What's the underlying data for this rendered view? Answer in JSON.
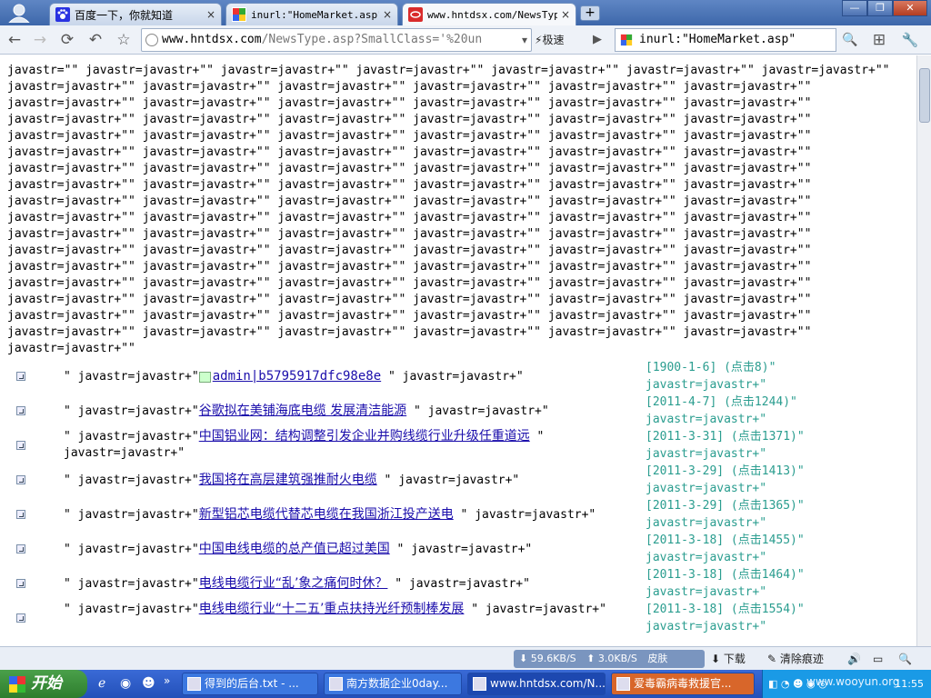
{
  "tabs": [
    {
      "title": "百度一下，你就知道",
      "close": "×"
    },
    {
      "title": "inurl:\"HomeMarket.asp\" -",
      "close": "×"
    },
    {
      "title": "www.hntdsx.com/NewsType.",
      "close": "×"
    }
  ],
  "newtab_label": "+",
  "window_controls": {
    "min": "—",
    "restore": "❐",
    "close": "✕"
  },
  "toolbar": {
    "back": "←",
    "forward": "→",
    "reload": "⟳",
    "undo": "↶",
    "star": "☆",
    "address_host": "www.hntdsx.com",
    "address_rest": "/NewsType.asp?SmallClass='%20un",
    "dropdown": "▾",
    "speed_label": "极速",
    "go": "▶",
    "search_query": "inurl:\"HomeMarket.asp\"",
    "search_btn": "🔍",
    "ext": "⊞",
    "tools": "🔧"
  },
  "junk_text": "javastr=\"\" javastr=javastr+\"\" javastr=javastr+\"\" javastr=javastr+\"\" javastr=javastr+\"\" javastr=javastr+\"\" javastr=javastr+\"\"\njavastr=javastr+\"\" javastr=javastr+\"\" javastr=javastr+\"\" javastr=javastr+\"\" javastr=javastr+\"\" javastr=javastr+\"\"\njavastr=javastr+\"\" javastr=javastr+\"\" javastr=javastr+\"\" javastr=javastr+\"\" javastr=javastr+\"\" javastr=javastr+\"\"\njavastr=javastr+\"\" javastr=javastr+\"\" javastr=javastr+\"\" javastr=javastr+\"\" javastr=javastr+\"\" javastr=javastr+\"\"\njavastr=javastr+\"\" javastr=javastr+\"\" javastr=javastr+\"\" javastr=javastr+\"\" javastr=javastr+\"\" javastr=javastr+\"\"\njavastr=javastr+\"\" javastr=javastr+\"\" javastr=javastr+\"\" javastr=javastr+\"\" javastr=javastr+\"\" javastr=javastr+\"\"\njavastr=javastr+\"\" javastr=javastr+\"\" javastr=javastr+\"\" javastr=javastr+\"\" javastr=javastr+\"\" javastr=javastr+\"\"\njavastr=javastr+\"\" javastr=javastr+\"\" javastr=javastr+\"\" javastr=javastr+\"\" javastr=javastr+\"\" javastr=javastr+\"\"\njavastr=javastr+\"\" javastr=javastr+\"\" javastr=javastr+\"\" javastr=javastr+\"\" javastr=javastr+\"\" javastr=javastr+\"\"\njavastr=javastr+\"\" javastr=javastr+\"\" javastr=javastr+\"\" javastr=javastr+\"\" javastr=javastr+\"\" javastr=javastr+\"\"\njavastr=javastr+\"\" javastr=javastr+\"\" javastr=javastr+\"\" javastr=javastr+\"\" javastr=javastr+\"\" javastr=javastr+\"\"\njavastr=javastr+\"\" javastr=javastr+\"\" javastr=javastr+\"\" javastr=javastr+\"\" javastr=javastr+\"\" javastr=javastr+\"\"\njavastr=javastr+\"\" javastr=javastr+\"\" javastr=javastr+\"\" javastr=javastr+\"\" javastr=javastr+\"\" javastr=javastr+\"\"\njavastr=javastr+\"\" javastr=javastr+\"\" javastr=javastr+\"\" javastr=javastr+\"\" javastr=javastr+\"\" javastr=javastr+\"\"\njavastr=javastr+\"\" javastr=javastr+\"\" javastr=javastr+\"\" javastr=javastr+\"\" javastr=javastr+\"\" javastr=javastr+\"\"\njavastr=javastr+\"\" javastr=javastr+\"\" javastr=javastr+\"\" javastr=javastr+\"\" javastr=javastr+\"\" javastr=javastr+\"\"\njavastr=javastr+\"\" javastr=javastr+\"\" javastr=javastr+\"\" javastr=javastr+\"\" javastr=javastr+\"\" javastr=javastr+\"\"\njavastr=javastr+\"\"",
  "rows": [
    {
      "pre": "\" javastr=javastr+\"",
      "link": "admin|b5795917dfc98e8e",
      "post": " \" javastr=javastr+\"",
      "date": "[1900-1-6] (点击8)\"",
      "sub": "javastr=javastr+\""
    },
    {
      "pre": "\" javastr=javastr+\"",
      "link": "谷歌拟在美铺海底电缆 发展清洁能源",
      "post": " \" javastr=javastr+\"",
      "date": "[2011-4-7] (点击1244)\"",
      "sub": "javastr=javastr+\""
    },
    {
      "pre": "\" javastr=javastr+\"",
      "link": "中国铝业网：结构调整引发企业并购线缆行业升级任重道远",
      "post": " \" javastr=javastr+\"",
      "date": "[2011-3-31] (点击1371)\"",
      "sub": "javastr=javastr+\""
    },
    {
      "pre": "\" javastr=javastr+\"",
      "link": "我国将在高层建筑强推耐火电缆",
      "post": " \" javastr=javastr+\"",
      "date": "[2011-3-29] (点击1413)\"",
      "sub": "javastr=javastr+\""
    },
    {
      "pre": "\" javastr=javastr+\"",
      "link": "新型铝芯电缆代替芯电缆在我国浙江投产送电",
      "post": " \" javastr=javastr+\"",
      "date": "[2011-3-29] (点击1365)\"",
      "sub": "javastr=javastr+\""
    },
    {
      "pre": "\" javastr=javastr+\"",
      "link": "中国电线电缆的总产值已超过美国",
      "post": " \" javastr=javastr+\"",
      "date": "[2011-3-18] (点击1455)\"",
      "sub": "javastr=javastr+\""
    },
    {
      "pre": "\" javastr=javastr+\"",
      "link": "电线电缆行业“乱’象之痛何时休？",
      "post": " \" javastr=javastr+\"",
      "date": "[2011-3-18] (点击1464)\"",
      "sub": "javastr=javastr+\""
    },
    {
      "pre": "\" javastr=javastr+\"",
      "link": "电线电缆行业“十二五’重点扶持光纤预制棒发展",
      "post": " \" javastr=javastr+\"",
      "date": "[2011-3-18] (点击1554)\"",
      "sub": "javastr=javastr+\""
    }
  ],
  "statusbar": {
    "down_speed": "59.6KB/S",
    "up_speed": "3.0KB/S",
    "skin": "皮肤",
    "download": "下载",
    "clear": "清除痕迹"
  },
  "taskbar": {
    "start": "开始",
    "tasks": [
      {
        "label": "得到的后台.txt - ..."
      },
      {
        "label": "南方数据企业0day..."
      },
      {
        "label": "www.hntdsx.com/N..."
      },
      {
        "label": "爱毒霸病毒救援官..."
      }
    ],
    "clock": "11:55",
    "watermark": "www.wooyun.org"
  }
}
